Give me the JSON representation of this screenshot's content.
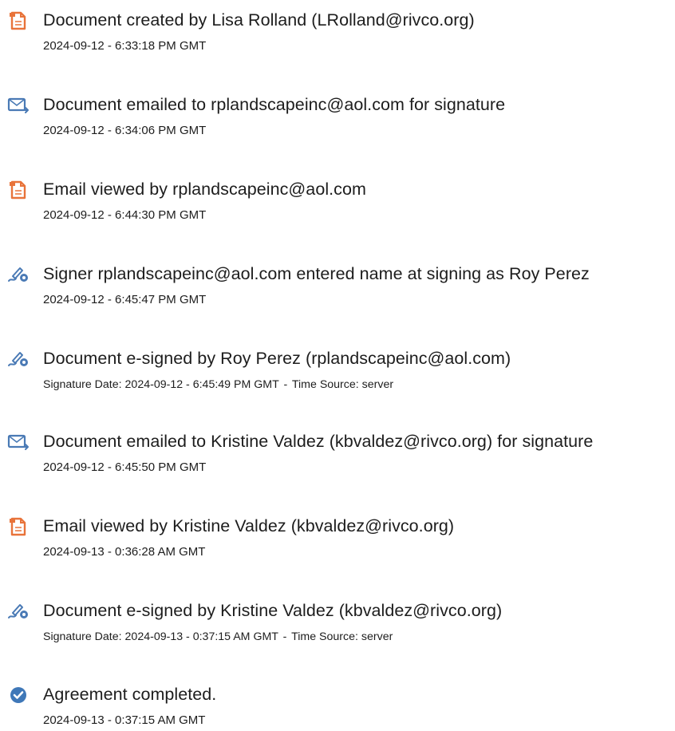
{
  "events": [
    {
      "icon": "document-icon",
      "title": "Document created by Lisa Rolland (LRolland@rivco.org)",
      "timestamp": "2024-09-12 - 6:33:18 PM GMT"
    },
    {
      "icon": "email-icon",
      "title": "Document emailed to rplandscapeinc@aol.com for signature",
      "timestamp": "2024-09-12 - 6:34:06 PM GMT"
    },
    {
      "icon": "document-icon",
      "title": "Email viewed by rplandscapeinc@aol.com",
      "timestamp": "2024-09-12 - 6:44:30 PM GMT"
    },
    {
      "icon": "signature-pen-icon",
      "title": "Signer rplandscapeinc@aol.com entered name at signing as Roy Perez",
      "timestamp": "2024-09-12 - 6:45:47 PM GMT"
    },
    {
      "icon": "signature-pen-icon",
      "title": "Document e-signed by Roy Perez (rplandscapeinc@aol.com)",
      "signature_date_label": "Signature Date:",
      "signature_date": "2024-09-12 - 6:45:49 PM GMT",
      "time_source_label": "Time Source:",
      "time_source": "server"
    },
    {
      "icon": "email-icon",
      "title": "Document emailed to Kristine Valdez (kbvaldez@rivco.org) for signature",
      "timestamp": "2024-09-12 - 6:45:50 PM GMT"
    },
    {
      "icon": "document-icon",
      "title": "Email viewed by Kristine Valdez (kbvaldez@rivco.org)",
      "timestamp": "2024-09-13 - 0:36:28 AM GMT"
    },
    {
      "icon": "signature-pen-icon",
      "title": "Document e-signed by Kristine Valdez (kbvaldez@rivco.org)",
      "signature_date_label": "Signature Date:",
      "signature_date": "2024-09-13 - 0:37:15 AM GMT",
      "time_source_label": "Time Source:",
      "time_source": "server"
    },
    {
      "icon": "check-circle-icon",
      "title": "Agreement completed.",
      "timestamp": "2024-09-13 - 0:37:15 AM GMT"
    }
  ],
  "colors": {
    "document_icon": "#e8733a",
    "email_icon": "#4a7ab5",
    "signature_icon": "#4a7ab5",
    "check_icon": "#3f78b8",
    "text": "#1d1d1d"
  }
}
